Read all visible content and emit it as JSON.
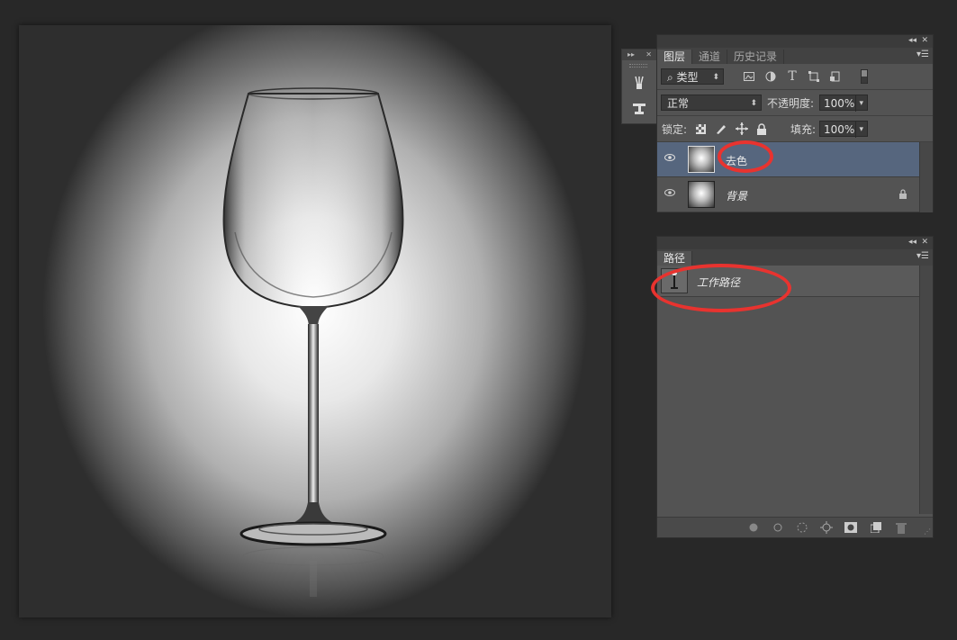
{
  "layers_panel": {
    "tabs": [
      {
        "label": "图层",
        "active": true
      },
      {
        "label": "通道",
        "active": false
      },
      {
        "label": "历史记录",
        "active": false
      }
    ],
    "filter_kind": "类型",
    "blend_mode": "正常",
    "opacity_label": "不透明度:",
    "opacity_value": "100%",
    "lock_label": "锁定:",
    "fill_label": "填充:",
    "fill_value": "100%",
    "layers": [
      {
        "name": "去色",
        "selected": true,
        "locked": false
      },
      {
        "name": "背景",
        "selected": false,
        "locked": true
      }
    ]
  },
  "paths_panel": {
    "tab": "路径",
    "paths": [
      {
        "name": "工作路径"
      }
    ]
  },
  "colors": {
    "selection": "#56667e",
    "annotation_red": "#e8332f"
  }
}
